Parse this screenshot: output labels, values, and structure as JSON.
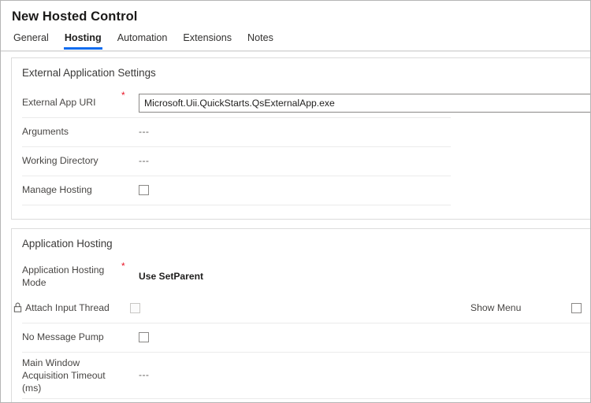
{
  "window": {
    "title": "New Hosted Control"
  },
  "tabs": [
    {
      "label": "General",
      "active": false
    },
    {
      "label": "Hosting",
      "active": true
    },
    {
      "label": "Automation",
      "active": false
    },
    {
      "label": "Extensions",
      "active": false
    },
    {
      "label": "Notes",
      "active": false
    }
  ],
  "colors": {
    "accent": "#0f6cf0",
    "required_asterisk": "#e81123",
    "card_border": "#dcdcdc",
    "row_separator": "#ebebeb",
    "text_primary": "#323130",
    "text_secondary": "#484644"
  },
  "sections": [
    {
      "title": "External Application Settings",
      "fields": [
        {
          "label": "External App URI",
          "required": "*",
          "control": "textbox",
          "value": "Microsoft.Uii.QuickStarts.QsExternalApp.exe"
        },
        {
          "label": "Arguments",
          "required": "",
          "control": "text",
          "value": "---"
        },
        {
          "label": "Working Directory",
          "required": "",
          "control": "text",
          "value": "---"
        },
        {
          "label": "Manage Hosting",
          "required": "",
          "control": "checkbox",
          "value": ""
        }
      ]
    },
    {
      "title": "Application Hosting",
      "fields": [
        {
          "label": "Application Hosting Mode",
          "required": "*",
          "control": "strong-text",
          "value": "Use SetParent"
        },
        {
          "label": "Attach Input Thread",
          "required": "",
          "control": "checkbox-muted",
          "value": "",
          "icon": "lock-icon",
          "right_label": "Show Menu",
          "right_control": "checkbox"
        },
        {
          "label": "No Message Pump",
          "required": "",
          "control": "checkbox",
          "value": ""
        },
        {
          "label": "Main Window Acquisition Timeout (ms)",
          "required": "",
          "control": "text",
          "value": "---"
        }
      ]
    }
  ]
}
